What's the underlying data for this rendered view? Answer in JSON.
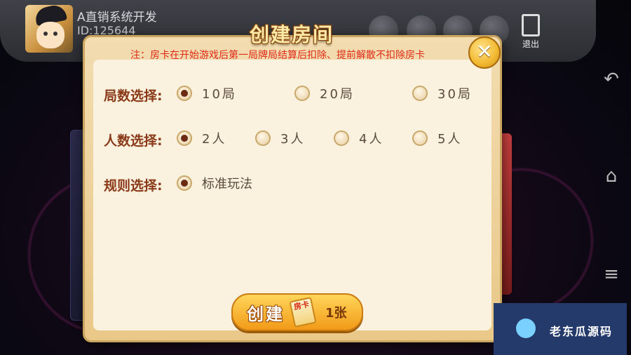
{
  "header": {
    "username": "A直销系统开发",
    "user_id": "ID:125644",
    "exit_label": "退出"
  },
  "dialog": {
    "title": "创建房间",
    "notice": "注：房卡在开始游戏后第一局牌局结算后扣除、提前解散不扣除房卡",
    "rows": [
      {
        "label": "局数选择:",
        "options": [
          "10局",
          "20局",
          "30局"
        ],
        "selected": 0
      },
      {
        "label": "人数选择:",
        "options": [
          "2人",
          "3人",
          "4人",
          "5人"
        ],
        "selected": 0
      },
      {
        "label": "规则选择:",
        "options": [
          "标准玩法"
        ],
        "selected": 0
      }
    ],
    "create_label": "创建",
    "card_label": "房卡",
    "card_count": "1张"
  },
  "watermark": "老东瓜源码",
  "colors": {
    "title": "#ffe9a8",
    "notice": "#e02a18",
    "label": "#8a3a18",
    "button": "#f2b830"
  }
}
